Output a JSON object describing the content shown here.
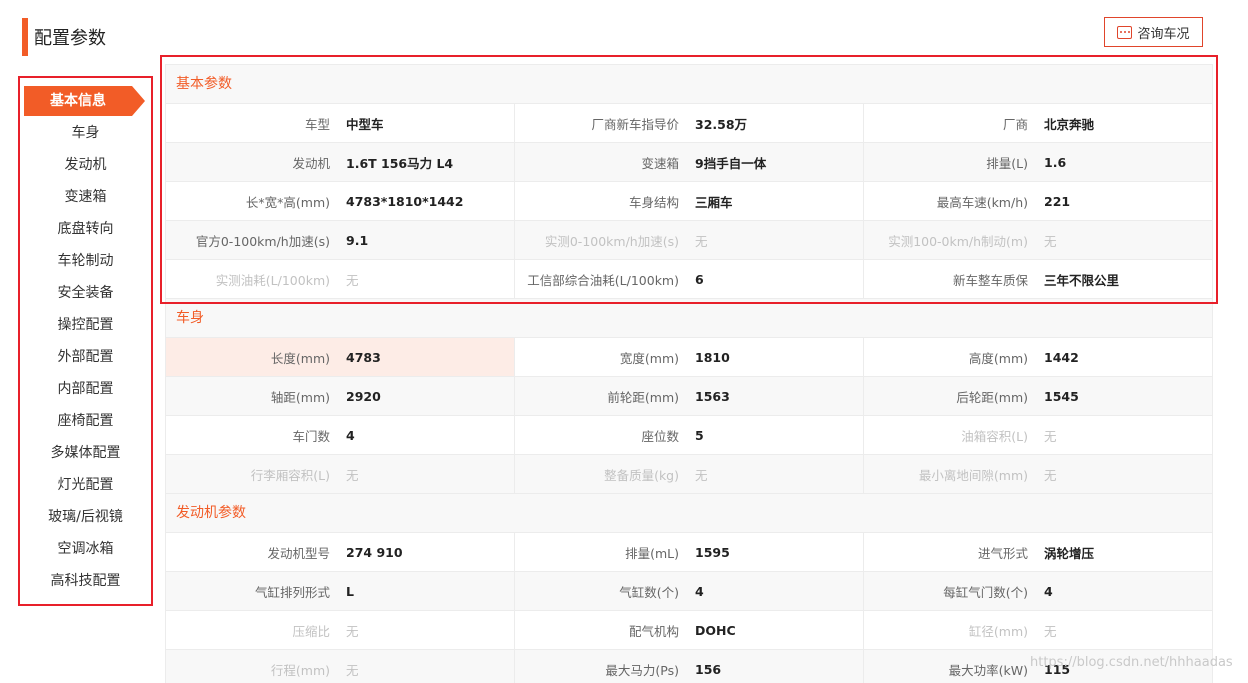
{
  "page": {
    "title": "配置参数",
    "consult_label": "咨询车况",
    "watermark": "https://blog.csdn.net/hhhaadas"
  },
  "colors": {
    "accent": "#f25c27",
    "highlight_border": "#e8202a"
  },
  "sidebar": {
    "items": [
      {
        "label": "基本信息",
        "active": true
      },
      {
        "label": "车身"
      },
      {
        "label": "发动机"
      },
      {
        "label": "变速箱"
      },
      {
        "label": "底盘转向"
      },
      {
        "label": "车轮制动"
      },
      {
        "label": "安全装备"
      },
      {
        "label": "操控配置"
      },
      {
        "label": "外部配置"
      },
      {
        "label": "内部配置"
      },
      {
        "label": "座椅配置"
      },
      {
        "label": "多媒体配置"
      },
      {
        "label": "灯光配置"
      },
      {
        "label": "玻璃/后视镜"
      },
      {
        "label": "空调冰箱"
      },
      {
        "label": "高科技配置"
      }
    ]
  },
  "sections": [
    {
      "title": "基本参数",
      "rows": [
        [
          {
            "label": "车型",
            "value": "中型车"
          },
          {
            "label": "厂商新车指导价",
            "value": "32.58万"
          },
          {
            "label": "厂商",
            "value": "北京奔驰"
          }
        ],
        [
          {
            "label": "发动机",
            "value": "1.6T 156马力 L4"
          },
          {
            "label": "变速箱",
            "value": "9挡手自一体"
          },
          {
            "label": "排量(L)",
            "value": "1.6"
          }
        ],
        [
          {
            "label": "长*宽*高(mm)",
            "value": "4783*1810*1442"
          },
          {
            "label": "车身结构",
            "value": "三厢车"
          },
          {
            "label": "最高车速(km/h)",
            "value": "221"
          }
        ],
        [
          {
            "label": "官方0-100km/h加速(s)",
            "value": "9.1"
          },
          {
            "label": "实测0-100km/h加速(s)",
            "value": "无",
            "empty": true
          },
          {
            "label": "实测100-0km/h制动(m)",
            "value": "无",
            "empty": true
          }
        ],
        [
          {
            "label": "实测油耗(L/100km)",
            "value": "无",
            "empty": true
          },
          {
            "label": "工信部综合油耗(L/100km)",
            "value": "6"
          },
          {
            "label": "新车整车质保",
            "value": "三年不限公里"
          }
        ]
      ]
    },
    {
      "title": "车身",
      "rows": [
        [
          {
            "label": "长度(mm)",
            "value": "4783",
            "highlight": true
          },
          {
            "label": "宽度(mm)",
            "value": "1810"
          },
          {
            "label": "高度(mm)",
            "value": "1442"
          }
        ],
        [
          {
            "label": "轴距(mm)",
            "value": "2920"
          },
          {
            "label": "前轮距(mm)",
            "value": "1563"
          },
          {
            "label": "后轮距(mm)",
            "value": "1545"
          }
        ],
        [
          {
            "label": "车门数",
            "value": "4"
          },
          {
            "label": "座位数",
            "value": "5"
          },
          {
            "label": "油箱容积(L)",
            "value": "无",
            "empty": true
          }
        ],
        [
          {
            "label": "行李厢容积(L)",
            "value": "无",
            "empty": true
          },
          {
            "label": "整备质量(kg)",
            "value": "无",
            "empty": true
          },
          {
            "label": "最小离地间隙(mm)",
            "value": "无",
            "empty": true
          }
        ]
      ]
    },
    {
      "title": "发动机参数",
      "rows": [
        [
          {
            "label": "发动机型号",
            "value": "274 910"
          },
          {
            "label": "排量(mL)",
            "value": "1595"
          },
          {
            "label": "进气形式",
            "value": "涡轮增压"
          }
        ],
        [
          {
            "label": "气缸排列形式",
            "value": "L"
          },
          {
            "label": "气缸数(个)",
            "value": "4"
          },
          {
            "label": "每缸气门数(个)",
            "value": "4"
          }
        ],
        [
          {
            "label": "压缩比",
            "value": "无",
            "empty": true
          },
          {
            "label": "配气机构",
            "value": "DOHC"
          },
          {
            "label": "缸径(mm)",
            "value": "无",
            "empty": true
          }
        ],
        [
          {
            "label": "行程(mm)",
            "value": "无",
            "empty": true
          },
          {
            "label": "最大马力(Ps)",
            "value": "156"
          },
          {
            "label": "最大功率(kW)",
            "value": "115"
          }
        ]
      ]
    }
  ]
}
